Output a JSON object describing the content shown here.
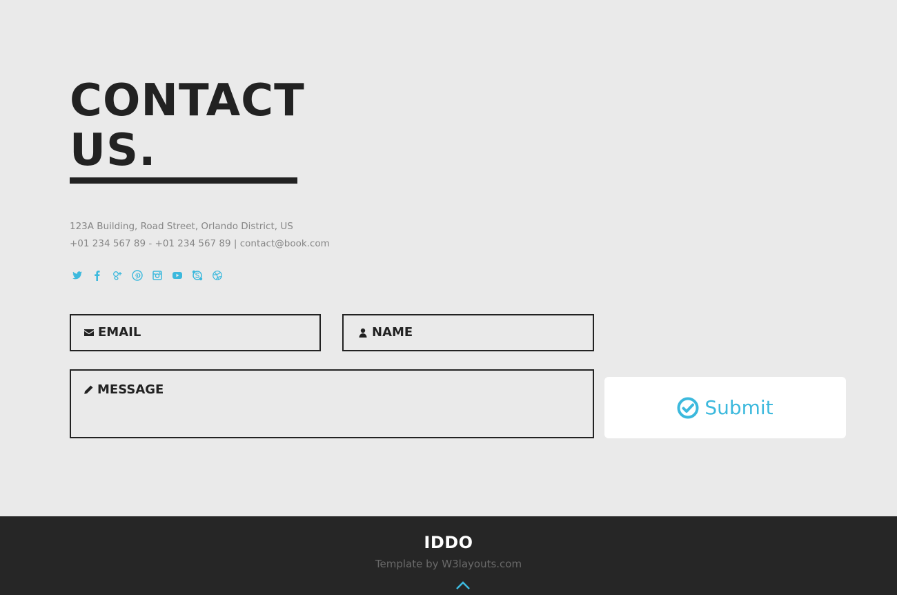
{
  "contact": {
    "title_line1": "CONTACT",
    "title_line2": "US.",
    "address": "123A Building, Road Street, Orlando District, US",
    "phones_email": "+01 234 567 89 - +01 234 567 89 | contact@book.com"
  },
  "social": [
    "twitter-icon",
    "facebook-icon",
    "google-plus-icon",
    "pinterest-icon",
    "instagram-icon",
    "youtube-icon",
    "skype-icon",
    "dribbble-icon"
  ],
  "form": {
    "email_label": "EMAIL",
    "name_label": "NAME",
    "message_label": "MESSAGE",
    "submit_label": "Submit"
  },
  "footer": {
    "brand": "IDDO",
    "credit_prefix": "Template by ",
    "credit_link": "W3layouts.com"
  },
  "colors": {
    "accent": "#3cb9dd",
    "background": "#eaeaea",
    "dark": "#222222",
    "footer": "#262626"
  }
}
